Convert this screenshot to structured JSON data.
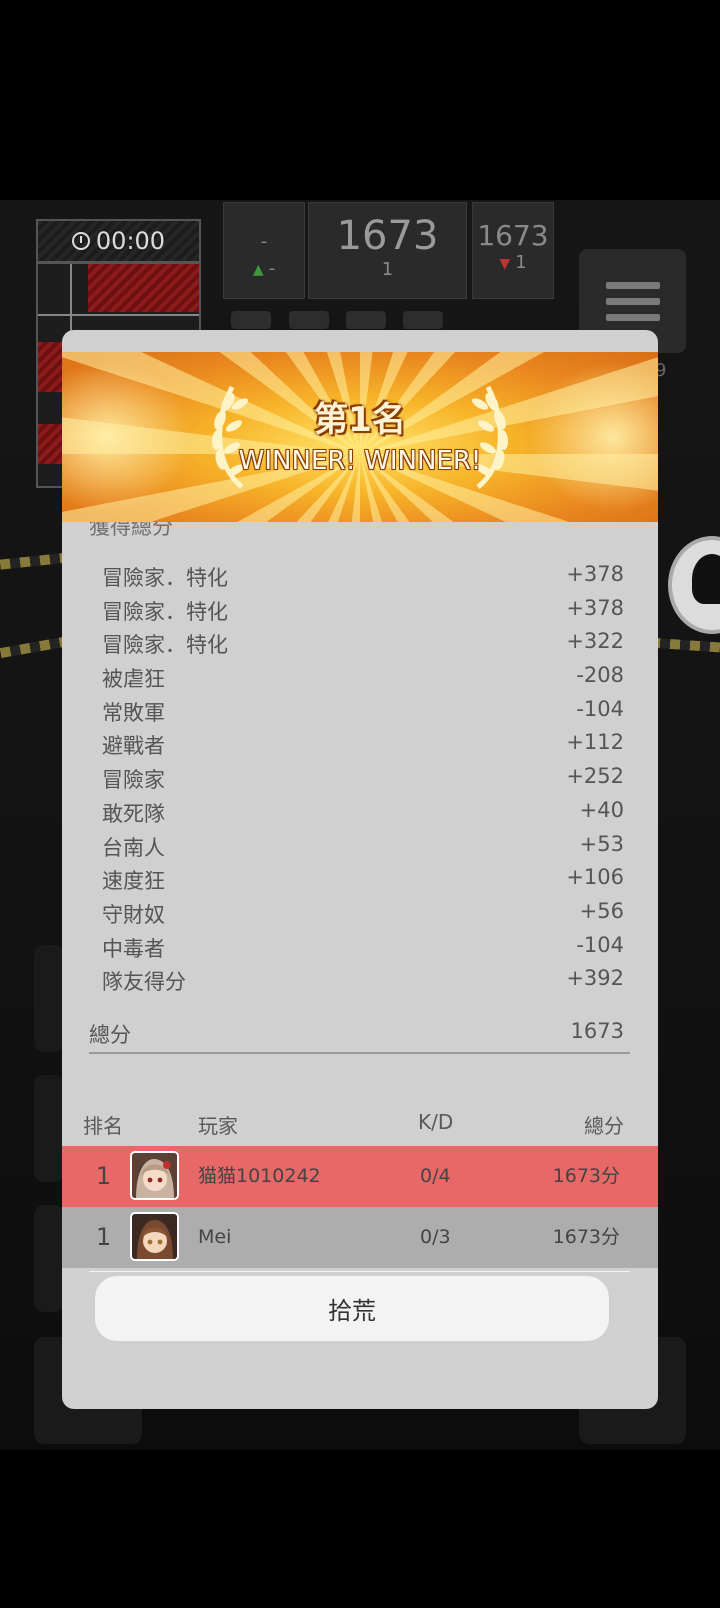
{
  "hud": {
    "timer": "00:00",
    "left_panel": {
      "value": "-",
      "delta": "-"
    },
    "center_panel": {
      "score": "1673",
      "rank": "1"
    },
    "right_panel": {
      "score": "1673",
      "delta": "1"
    },
    "side_number": "9"
  },
  "banner": {
    "title": "第1名",
    "subtitle": "WINNER! WINNER!"
  },
  "breakdown": {
    "section_title": "獲得總分",
    "items": [
      {
        "label": "冒險家．特化",
        "value": "+378"
      },
      {
        "label": "冒險家．特化",
        "value": "+378"
      },
      {
        "label": "冒險家．特化",
        "value": "+322"
      },
      {
        "label": "被虐狂",
        "value": "-208"
      },
      {
        "label": "常敗軍",
        "value": "-104"
      },
      {
        "label": "避戰者",
        "value": "+112"
      },
      {
        "label": "冒險家",
        "value": "+252"
      },
      {
        "label": "敢死隊",
        "value": "+40"
      },
      {
        "label": "台南人",
        "value": "+53"
      },
      {
        "label": "速度狂",
        "value": "+106"
      },
      {
        "label": "守財奴",
        "value": "+56"
      },
      {
        "label": "中毒者",
        "value": "-104"
      },
      {
        "label": "隊友得分",
        "value": "+392"
      }
    ],
    "total_label": "總分",
    "total_value": "1673"
  },
  "ranking": {
    "headers": {
      "rank": "排名",
      "player": "玩家",
      "kd": "K/D",
      "score": "總分"
    },
    "rows": [
      {
        "rank": "1",
        "name": "猫猫1010242",
        "kd": "0/4",
        "score": "1673分",
        "highlight": true
      },
      {
        "rank": "1",
        "name": "Mei",
        "kd": "0/3",
        "score": "1673分",
        "highlight": false
      }
    ]
  },
  "button": {
    "label": "拾荒"
  },
  "colors": {
    "highlight_row": "#e86868",
    "second_row": "#adadad",
    "modal_bg": "#d0d0d0",
    "banner_orange": "#f7b52a"
  }
}
